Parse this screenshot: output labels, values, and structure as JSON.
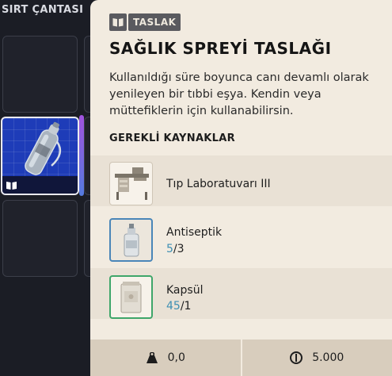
{
  "backpack": {
    "title": "SIRT ÇANTASI"
  },
  "card": {
    "tag_label": "TASLAK",
    "title": "SAĞLIK SPREYİ TASLAĞI",
    "description": "Kullanıldığı süre boyunca canı devamlı olarak yenileyen bir tıbbi eşya. Kendin veya müttefiklerin için kullanabilirsin.",
    "requirements_title": "GEREKLİ KAYNAKLAR",
    "resources": [
      {
        "name": "Tıp Laboratuvarı III",
        "have": "",
        "need": "",
        "icon": "medical-lab-icon"
      },
      {
        "name": "Antiseptik",
        "have": "5",
        "need": "/3",
        "icon": "antiseptic-bottle-icon"
      },
      {
        "name": "Kapsül",
        "have": "45",
        "need": "/1",
        "icon": "capsule-box-icon"
      }
    ],
    "footer": {
      "weight": "0,0",
      "value": "5.000"
    }
  },
  "colors": {
    "card_bg": "#f2ebe0",
    "quantity_have": "#3d8fb3",
    "slot_selected": "#1e3cb8",
    "tag_bg": "#5a5a5f"
  }
}
